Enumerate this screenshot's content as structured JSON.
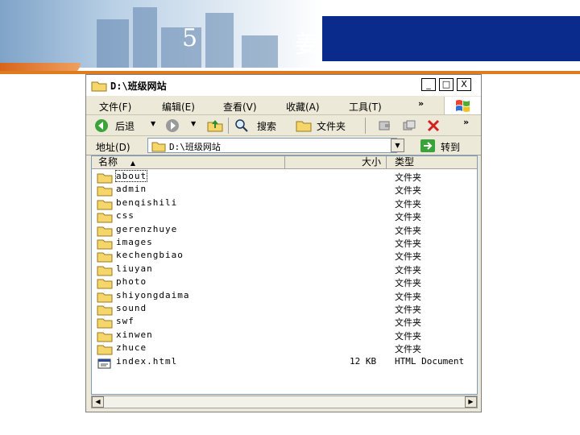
{
  "slide": {
    "title_left": "5",
    "title_right": "姜"
  },
  "window": {
    "title": "D:\\班级网站",
    "min_label": "_",
    "max_label": "□",
    "close_label": "X"
  },
  "menu": {
    "items": [
      "文件(F)",
      "编辑(E)",
      "查看(V)",
      "收藏(A)",
      "工具(T)"
    ],
    "more": "»"
  },
  "toolbar": {
    "back_label": "后退",
    "search_label": "搜索",
    "folders_label": "文件夹",
    "more": "»"
  },
  "address": {
    "label": "地址(D)",
    "value": "D:\\班级网站",
    "go_label": "转到"
  },
  "columns": {
    "name": "名称",
    "size": "大小",
    "type": "类型"
  },
  "files": [
    {
      "name": "about",
      "size": "",
      "type": "文件夹",
      "kind": "folder"
    },
    {
      "name": "admin",
      "size": "",
      "type": "文件夹",
      "kind": "folder"
    },
    {
      "name": "benqishili",
      "size": "",
      "type": "文件夹",
      "kind": "folder"
    },
    {
      "name": "css",
      "size": "",
      "type": "文件夹",
      "kind": "folder"
    },
    {
      "name": "gerenzhuye",
      "size": "",
      "type": "文件夹",
      "kind": "folder"
    },
    {
      "name": "images",
      "size": "",
      "type": "文件夹",
      "kind": "folder"
    },
    {
      "name": "kechengbiao",
      "size": "",
      "type": "文件夹",
      "kind": "folder"
    },
    {
      "name": "liuyan",
      "size": "",
      "type": "文件夹",
      "kind": "folder"
    },
    {
      "name": "photo",
      "size": "",
      "type": "文件夹",
      "kind": "folder"
    },
    {
      "name": "shiyongdaima",
      "size": "",
      "type": "文件夹",
      "kind": "folder"
    },
    {
      "name": "sound",
      "size": "",
      "type": "文件夹",
      "kind": "folder"
    },
    {
      "name": "swf",
      "size": "",
      "type": "文件夹",
      "kind": "folder"
    },
    {
      "name": "xinwen",
      "size": "",
      "type": "文件夹",
      "kind": "folder"
    },
    {
      "name": "zhuce",
      "size": "",
      "type": "文件夹",
      "kind": "folder"
    },
    {
      "name": "index.html",
      "size": "12 KB",
      "type": "HTML Document",
      "kind": "html"
    }
  ],
  "icons": {
    "folder": "folder-icon",
    "html": "html-file-icon",
    "back": "back-arrow-icon",
    "forward": "forward-arrow-icon",
    "up": "up-folder-icon",
    "search": "search-icon",
    "folders": "folders-icon",
    "delete": "delete-icon",
    "go": "go-arrow-icon"
  },
  "colors": {
    "header_blue": "#0a2a8c",
    "accent_orange": "#e07a1f",
    "folder_yellow": "#f5d66b"
  }
}
